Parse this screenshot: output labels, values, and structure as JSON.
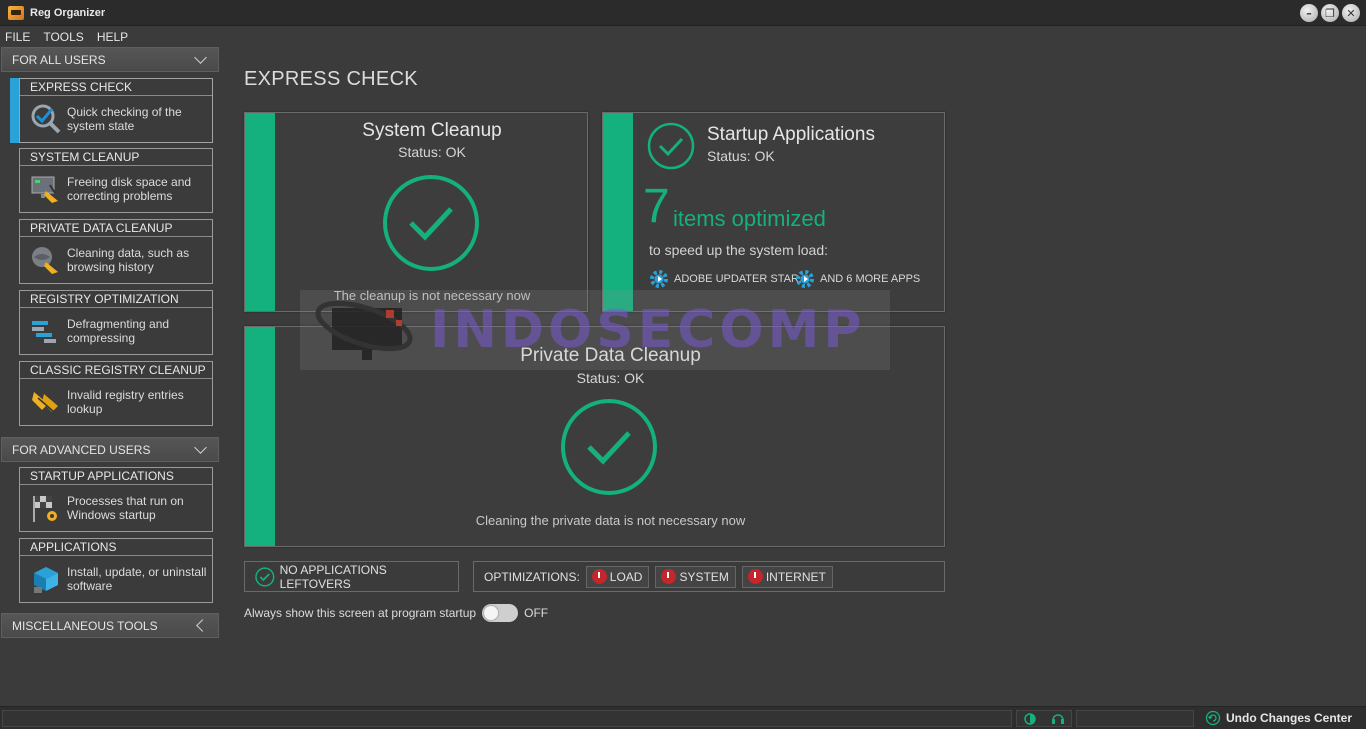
{
  "window": {
    "title": "Reg Organizer"
  },
  "window_controls": {
    "minimize": "–",
    "restore": "❐",
    "close": "✕"
  },
  "menu": [
    {
      "label": "FILE"
    },
    {
      "label": "TOOLS"
    },
    {
      "label": "HELP"
    }
  ],
  "sidebar": {
    "for_all_users": "FOR ALL USERS",
    "for_advanced_users": "FOR ADVANCED USERS",
    "misc_tools": "MISCELLANEOUS TOOLS",
    "items": [
      {
        "title": "EXPRESS CHECK",
        "desc": "Quick checking of the system state"
      },
      {
        "title": "SYSTEM CLEANUP",
        "desc": "Freeing disk space and correcting problems"
      },
      {
        "title": "PRIVATE DATA CLEANUP",
        "desc": "Cleaning data, such as browsing history"
      },
      {
        "title": "REGISTRY OPTIMIZATION",
        "desc": "Defragmenting and compressing"
      },
      {
        "title": "CLASSIC REGISTRY CLEANUP",
        "desc": "Invalid registry entries lookup"
      },
      {
        "title": "STARTUP APPLICATIONS",
        "desc": "Processes that run on Windows startup"
      },
      {
        "title": "APPLICATIONS",
        "desc": "Install, update, or uninstall software"
      }
    ]
  },
  "main": {
    "title": "EXPRESS CHECK",
    "system_cleanup": {
      "title": "System Cleanup",
      "status": "Status: OK",
      "message": "The cleanup is not necessary now"
    },
    "startup": {
      "title": "Startup Applications",
      "status": "Status: OK",
      "count": "7",
      "items_label": "items optimized",
      "sub": "to speed up the system load:",
      "app1": "ADOBE UPDATER STAR...",
      "app2": "AND 6 MORE APPS"
    },
    "private_data": {
      "title": "Private Data Cleanup",
      "status": "Status: OK",
      "message": "Cleaning the private data is not necessary now"
    },
    "leftovers": "NO APPLICATIONS LEFTOVERS",
    "optimizations": {
      "label": "OPTIMIZATIONS:",
      "chips": [
        "LOAD",
        "SYSTEM",
        "INTERNET"
      ]
    },
    "startup_screen": {
      "label": "Always show this screen at program startup",
      "state": "OFF"
    }
  },
  "statusbar": {
    "undo": "Undo Changes Center"
  },
  "watermark": {
    "text": "INDOSECOMP"
  },
  "colors": {
    "accent": "#14b07d",
    "active_bar": "#2aa2d8",
    "alert": "#c3272b"
  }
}
